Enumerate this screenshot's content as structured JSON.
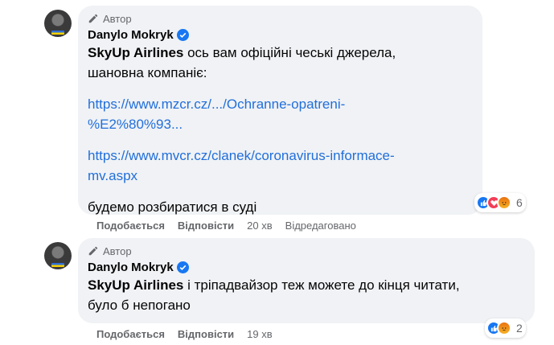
{
  "comments": [
    {
      "author_tag": "Автор",
      "name": "Danylo Mokryk",
      "mention": "SkyUp Airlines",
      "text_line1": " ось вам офіційні чеські джерела,",
      "text_line2": "шановна компаніє:",
      "link1_line1": "https://www.mzcr.cz/.../Ochranne-opatreni-",
      "link1_line2": "%E2%80%93...",
      "link2_line1": "https://www.mvcr.cz/clanek/coronavirus-informace-",
      "link2_line2": "mv.aspx",
      "text_tail": "будемо розбиратися в суді",
      "like_label": "Подобається",
      "reply_label": "Відповісти",
      "time": "20 хв",
      "edited": "Відредаговано",
      "reaction_count": "6",
      "reaction_icons": [
        "like-icon",
        "love-icon",
        "angry-icon"
      ]
    },
    {
      "author_tag": "Автор",
      "name": "Danylo Mokryk",
      "mention": "SkyUp Airlines",
      "text_line1": " і тріпадвайзор теж можете до кінця читати,",
      "text_line2": "було б непогано",
      "like_label": "Подобається",
      "reply_label": "Відповісти",
      "time": "19 хв",
      "reaction_count": "2",
      "reaction_icons": [
        "like-icon",
        "angry-icon"
      ]
    }
  ],
  "colors": {
    "link": "#216fdb",
    "bubble": "#f0f2f5",
    "secondary_text": "#65676b",
    "verified": "#1877f2"
  }
}
